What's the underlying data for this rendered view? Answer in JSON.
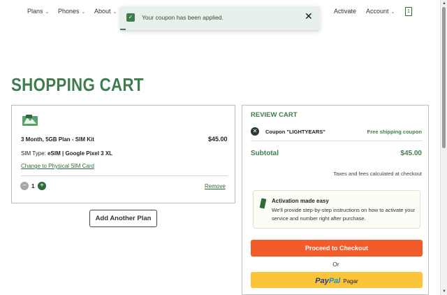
{
  "nav": {
    "items": [
      {
        "label": "Plans"
      },
      {
        "label": "Phones"
      },
      {
        "label": "About"
      },
      {
        "label": "Activate"
      },
      {
        "label": "Account"
      }
    ],
    "cart_count": "1"
  },
  "toast": {
    "message": "Your coupon has been applied.",
    "close": "✕"
  },
  "page": {
    "title": "SHOPPING CART"
  },
  "cart_item": {
    "name": "3 Month, 5GB Plan - SIM Kit",
    "price": "$45.00",
    "sim_type_label": "SIM Type:",
    "sim_type_value": "eSIM | Google Pixel 3 XL",
    "change_link": "Change to Physical SIM Card",
    "quantity": "1",
    "remove": "Remove"
  },
  "add_plan": "Add Another Plan",
  "review": {
    "title": "REVIEW CART",
    "coupon_label": "Coupon \"LIGHTYEARS\"",
    "coupon_value": "Free shipping coupon",
    "subtotal_label": "Subtotal",
    "subtotal_value": "$45.00",
    "taxes_note": "Taxes and fees calculated at checkout",
    "activation_title": "Activation made easy",
    "activation_body": "We'll provide step-by-step instructions on how to activate your service and number right after purchase.",
    "checkout_button": "Proceed to Checkout",
    "or_text": "Or",
    "paypal_pay": "Pay",
    "paypal_pal": "Pal",
    "paypal_pagar": "Pagar"
  },
  "colors": {
    "brand_green": "#3f7d4e",
    "checkout_orange": "#f25c2a",
    "paypal_yellow": "#fcc438"
  }
}
